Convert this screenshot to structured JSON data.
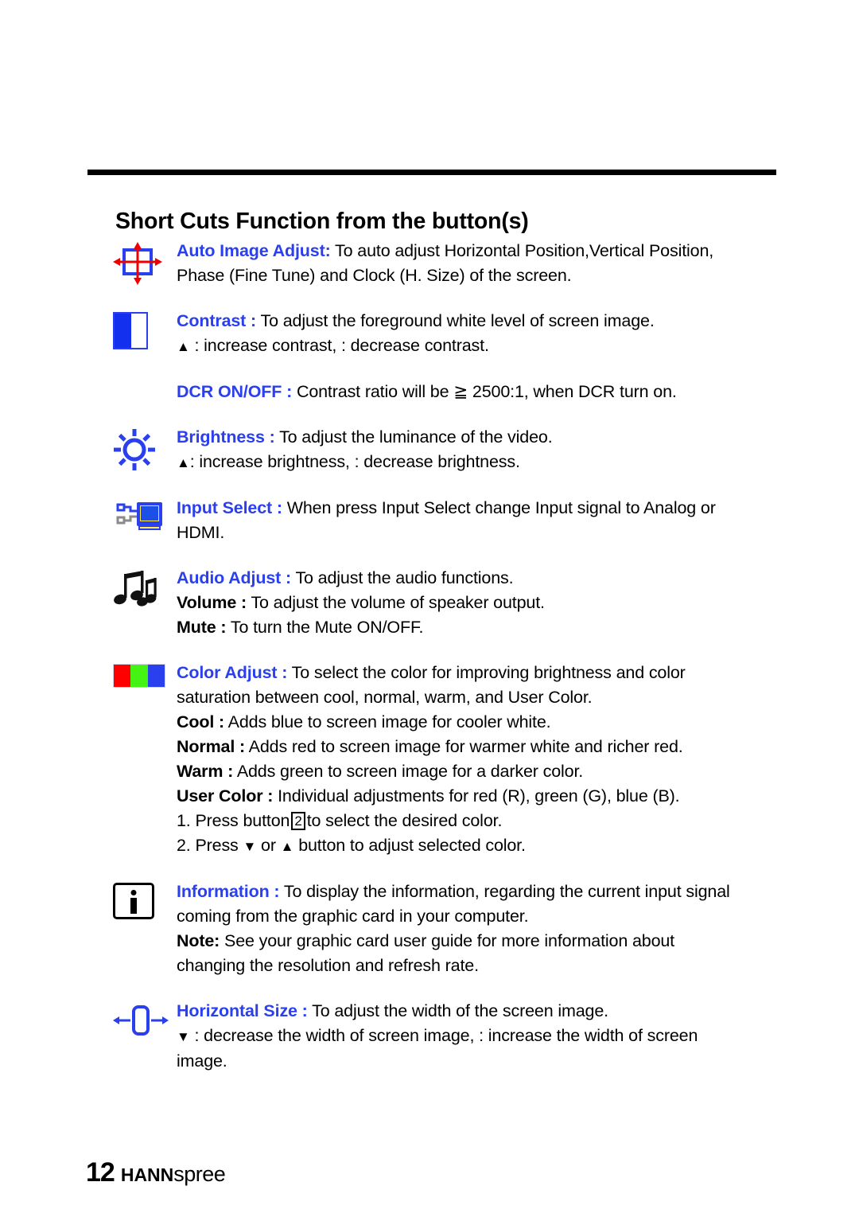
{
  "page": {
    "title": "Short Cuts Function from the button(s)",
    "number": "12",
    "brand_bold": "HANN",
    "brand_light": "spree"
  },
  "sections": [
    {
      "icon": "auto-image-adjust-icon",
      "heading": "Auto Image Adjust:",
      "lines": [
        "To auto adjust Horizontal Position,Vertical Position,",
        "Phase (Fine Tune) and Clock (H. Size) of the screen."
      ]
    },
    {
      "icon": "contrast-icon",
      "heading": "Contrast :",
      "lines": [
        "To adjust the foreground white level of screen image.",
        " : increase contrast,  : decrease contrast."
      ],
      "sub_heading": "DCR ON/OFF :",
      "sub_line": "Contrast ratio will be ≧ 2500:1, when DCR turn on."
    },
    {
      "icon": "brightness-icon",
      "heading": "Brightness :",
      "lines": [
        "To adjust the luminance of the video.",
        ": increase brightness,  : decrease brightness."
      ]
    },
    {
      "icon": "input-select-icon",
      "heading": "Input Select :",
      "lines": [
        "When press Input Select change Input signal to Analog or",
        "HDMI."
      ]
    },
    {
      "icon": "audio-adjust-icon",
      "heading": "Audio Adjust :",
      "lines": [
        "To adjust the audio functions."
      ],
      "bold_items": [
        {
          "key": "Volume :",
          "text": "To adjust the volume of speaker output."
        },
        {
          "key": "Mute :",
          "text": "To turn the Mute ON/OFF."
        }
      ]
    },
    {
      "icon": "color-adjust-icon",
      "heading": "Color Adjust :",
      "lines": [
        "To select the color for improving brightness and color",
        "saturation between cool, normal, warm, and User Color."
      ],
      "bold_items": [
        {
          "key": "Cool :",
          "text": "Adds blue to screen image for cooler white."
        },
        {
          "key": "Normal :",
          "text": "Adds red to screen image for warmer white and richer red."
        },
        {
          "key": "Warm :",
          "text": "Adds green to screen image for a darker color."
        },
        {
          "key": "User Color :",
          "text": "Individual adjustments for red (R), green (G), blue (B)."
        }
      ],
      "steps": {
        "step1_pre": "1. Press button",
        "step1_key": "2",
        "step1_post": "to select the desired color.",
        "step2_pre": "2. Press",
        "step2_mid": "or",
        "step2_post": "button to adjust selected color."
      }
    },
    {
      "icon": "information-icon",
      "heading": "Information :",
      "lines": [
        "To display the information, regarding the current input signal",
        "coming from the graphic card in your computer."
      ],
      "bold_items": [
        {
          "key": "Note:",
          "text": "See your graphic card user guide for more information about"
        }
      ],
      "trailing_line": "changing the resolution and refresh rate."
    },
    {
      "icon": "horizontal-size-icon",
      "heading": "Horizontal Size :",
      "lines": [
        "To adjust the width of the screen image.",
        " : decrease the width of screen image,  : increase the width of screen",
        "image."
      ]
    }
  ],
  "colors": {
    "heading_blue": "#2a3fee",
    "icon_red": "#fe0000",
    "icon_green": "#44f313",
    "text_black": "#000000"
  }
}
